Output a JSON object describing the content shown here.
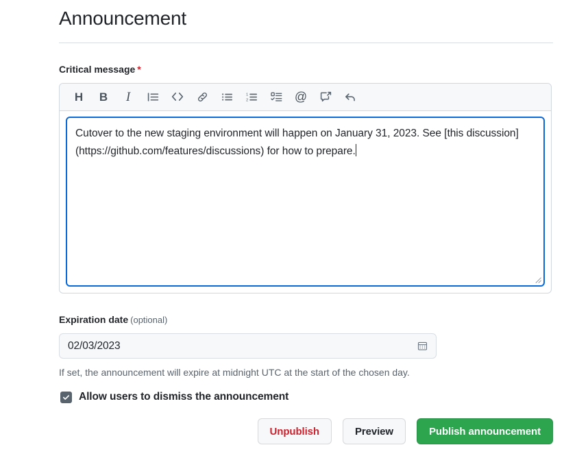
{
  "header": {
    "title": "Announcement"
  },
  "message_field": {
    "label": "Critical message",
    "required_marker": "*",
    "toolbar": [
      {
        "name": "heading-icon",
        "label": "Heading",
        "glyph": "H"
      },
      {
        "name": "bold-icon",
        "label": "Bold",
        "glyph": "B"
      },
      {
        "name": "italic-icon",
        "label": "Italic",
        "glyph": "I"
      },
      {
        "name": "quote-icon",
        "label": "Quote",
        "glyph": ""
      },
      {
        "name": "code-icon",
        "label": "Code",
        "glyph": "<>"
      },
      {
        "name": "link-icon",
        "label": "Link",
        "glyph": ""
      },
      {
        "name": "unordered-list-icon",
        "label": "Unordered list",
        "glyph": ""
      },
      {
        "name": "ordered-list-icon",
        "label": "Numbered list",
        "glyph": ""
      },
      {
        "name": "task-list-icon",
        "label": "Task list",
        "glyph": ""
      },
      {
        "name": "mention-icon",
        "label": "Mention",
        "glyph": "@"
      },
      {
        "name": "cross-reference-icon",
        "label": "Reference",
        "glyph": ""
      },
      {
        "name": "saved-reply-icon",
        "label": "Saved replies",
        "glyph": ""
      }
    ],
    "value": "Cutover to the new staging environment will happen on January 31, 2023. See [this discussion](https://github.com/features/discussions) for how to prepare.",
    "placeholder": "",
    "focused": true
  },
  "expiration_field": {
    "label": "Expiration date",
    "optional_label": "(optional)",
    "value": "02/03/2023",
    "placeholder": "mm/dd/yyyy",
    "helper_text": "If set, the announcement will expire at midnight UTC at the start of the chosen day.",
    "picker_icon": "calendar-icon"
  },
  "dismiss_option": {
    "label": "Allow users to dismiss the announcement",
    "checked": true
  },
  "actions": {
    "unpublish_label": "Unpublish",
    "preview_label": "Preview",
    "publish_label": "Publish announcement"
  },
  "colors": {
    "accent": "#0969DA",
    "danger": "#CF222E",
    "success": "#2DA44E",
    "border": "#D0D7DE",
    "muted_text": "#59636E",
    "toolbar_bg": "#F6F8FA"
  }
}
